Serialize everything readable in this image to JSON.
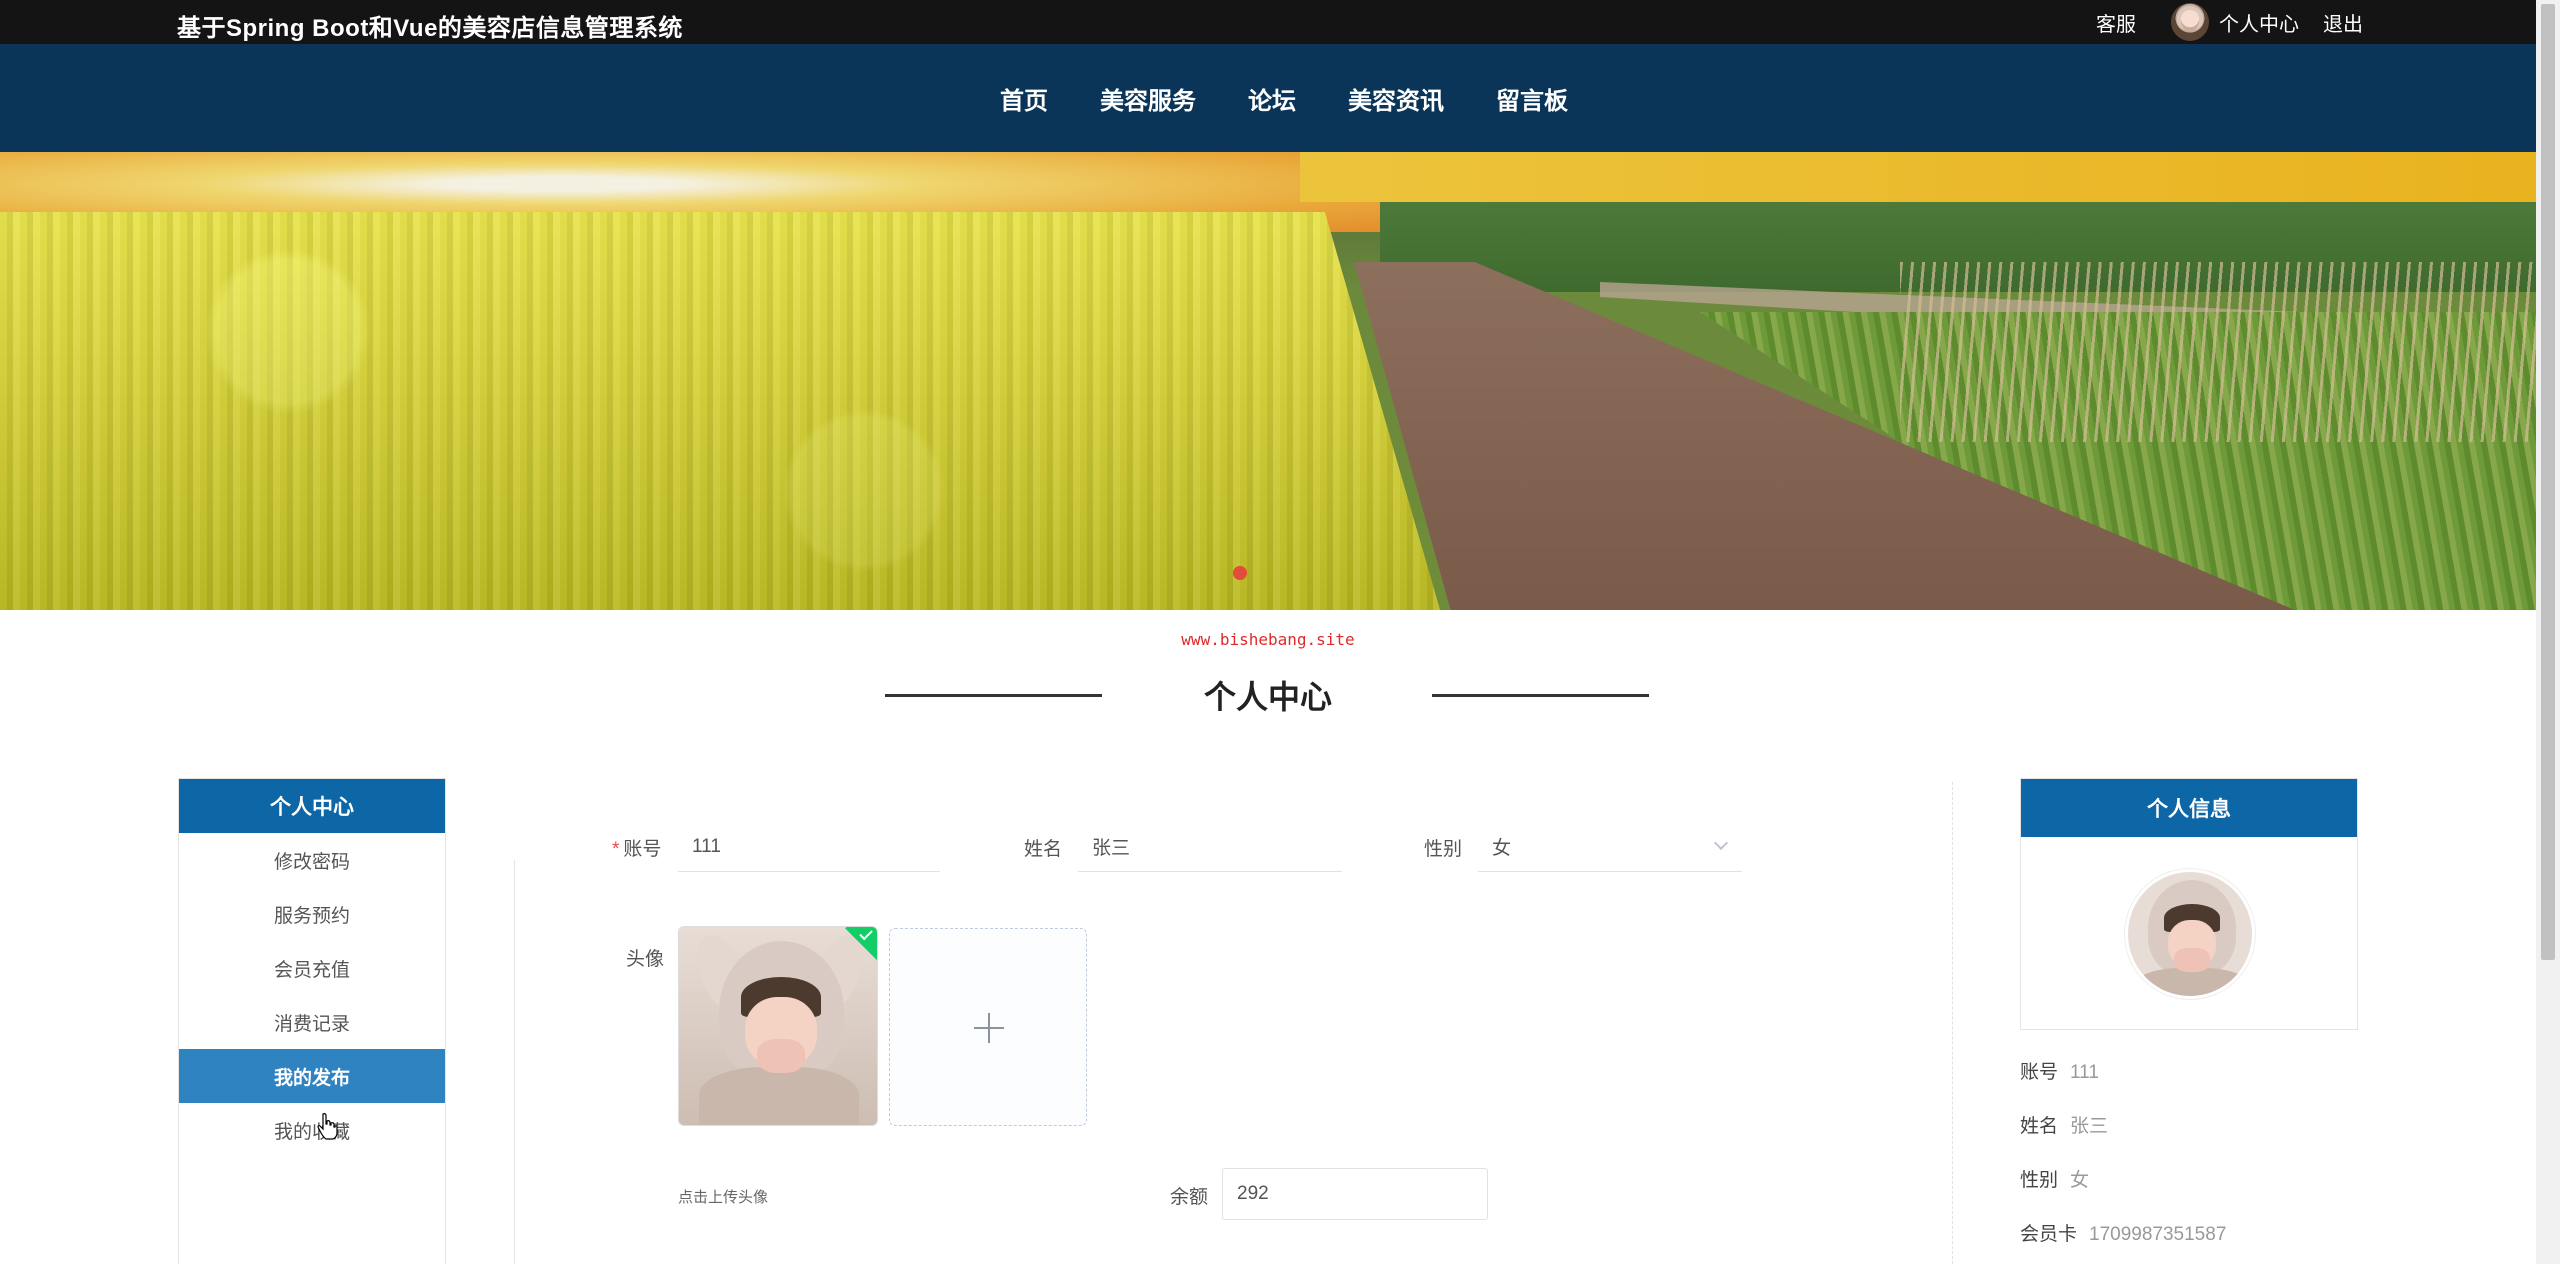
{
  "header": {
    "site_title": "基于Spring Boot和Vue的美容店信息管理系统",
    "customer_service": "客服",
    "personal_center": "个人中心",
    "logout": "退出"
  },
  "nav": {
    "items": [
      "首页",
      "美容服务",
      "论坛",
      "美容资讯",
      "留言板"
    ]
  },
  "banner": {
    "active_slide": 1
  },
  "watermark": "www.bishebang.site",
  "section_title": "个人中心",
  "sidebar": {
    "title": "个人中心",
    "items": [
      "修改密码",
      "服务预约",
      "会员充值",
      "消费记录",
      "我的发布",
      "我的收藏"
    ],
    "active_item": "我的发布"
  },
  "form": {
    "account_label": "账号",
    "account_value": "111",
    "name_label": "姓名",
    "name_value": "张三",
    "gender_label": "性别",
    "gender_value": "女",
    "avatar_label": "头像",
    "upload_tip": "点击上传头像",
    "balance_label": "余额",
    "balance_value": "292"
  },
  "info_panel": {
    "title": "个人信息",
    "account_label": "账号",
    "account_value": "111",
    "name_label": "姓名",
    "name_value": "张三",
    "gender_label": "性别",
    "gender_value": "女",
    "card_label": "会员卡",
    "card_value": "1709987351587"
  },
  "colors": {
    "topbar": "#141414",
    "navbar": "#0b3558",
    "accent": "#0d66a6",
    "active_menu": "#2f83c1",
    "success": "#13ce66",
    "required": "#e84b4b"
  }
}
